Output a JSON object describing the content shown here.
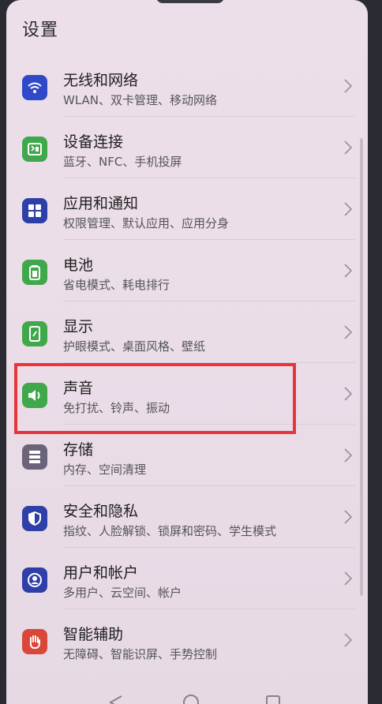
{
  "page_title": "设置",
  "items": [
    {
      "title": "无线和网络",
      "subtitle": "WLAN、双卡管理、移动网络",
      "icon": "wifi-icon",
      "color": "#2f49c9"
    },
    {
      "title": "设备连接",
      "subtitle": "蓝牙、NFC、手机投屏",
      "icon": "device-connect-icon",
      "color": "#3fa84a"
    },
    {
      "title": "应用和通知",
      "subtitle": "权限管理、默认应用、应用分身",
      "icon": "apps-grid-icon",
      "color": "#2f3fa8"
    },
    {
      "title": "电池",
      "subtitle": "省电模式、耗电排行",
      "icon": "battery-icon",
      "color": "#3fa84a"
    },
    {
      "title": "显示",
      "subtitle": "护眼模式、桌面风格、壁纸",
      "icon": "display-icon",
      "color": "#3fa84a"
    },
    {
      "title": "声音",
      "subtitle": "免打扰、铃声、振动",
      "icon": "speaker-icon",
      "color": "#3fa84a"
    },
    {
      "title": "存储",
      "subtitle": "内存、空间清理",
      "icon": "storage-icon",
      "color": "#6b6378"
    },
    {
      "title": "安全和隐私",
      "subtitle": "指纹、人脸解锁、锁屏和密码、学生模式",
      "icon": "shield-icon",
      "color": "#2f3fa8"
    },
    {
      "title": "用户和帐户",
      "subtitle": "多用户、云空间、帐户",
      "icon": "user-account-icon",
      "color": "#2f3fa8"
    },
    {
      "title": "智能辅助",
      "subtitle": "无障碍、智能识屏、手势控制",
      "icon": "hand-icon",
      "color": "#d9473a"
    }
  ],
  "highlight_color": "#e8353b"
}
